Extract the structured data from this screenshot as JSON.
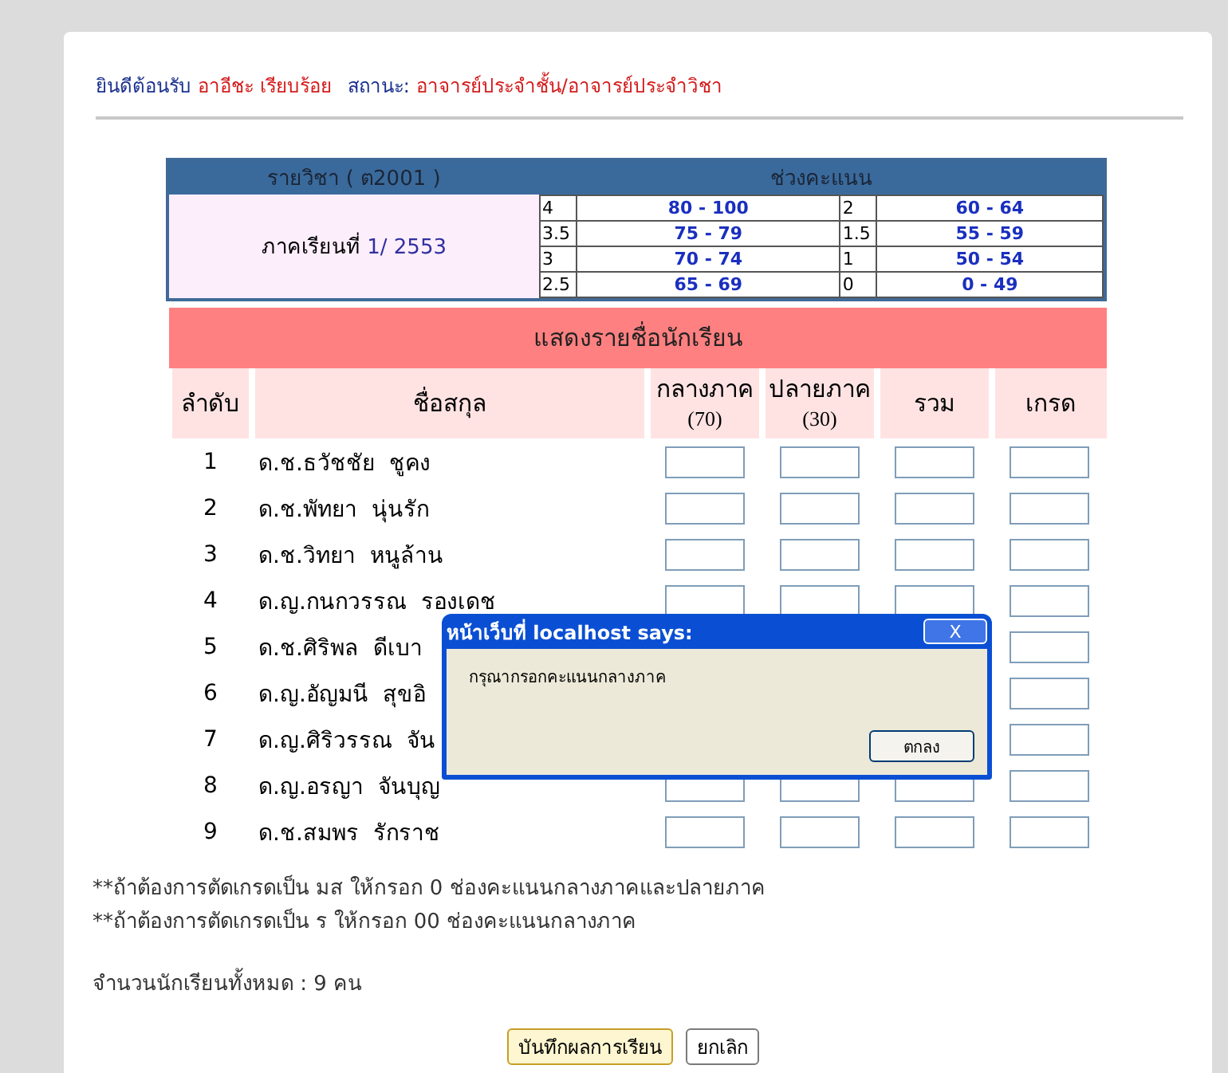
{
  "header": {
    "welcome": "ยินดีต้อนรับ",
    "user": "อาอีชะ เรียบร้อย",
    "status_label": "สถานะ:",
    "status": "อาจารย์ประจำชั้น/อาจารย์ประจำวิชา"
  },
  "subject": {
    "title": "รายวิชา ( ต2001 )",
    "term_label": "ภาคเรียนที่",
    "term": "1/",
    "year": "2553"
  },
  "score_ranges": {
    "title": "ช่วงคะแนน",
    "items": [
      {
        "grade": "4",
        "range": "80 - 100"
      },
      {
        "grade": "2",
        "range": "60 - 64"
      },
      {
        "grade": "3.5",
        "range": "75 - 79"
      },
      {
        "grade": "1.5",
        "range": "55 - 59"
      },
      {
        "grade": "3",
        "range": "70 - 74"
      },
      {
        "grade": "1",
        "range": "50 - 54"
      },
      {
        "grade": "2.5",
        "range": "65 - 69"
      },
      {
        "grade": "0",
        "range": "0 - 49"
      }
    ]
  },
  "student_table": {
    "title": "แสดงรายชื่อนักเรียน",
    "columns": [
      {
        "label": "ลำดับ"
      },
      {
        "label": "ชื่อสกุล"
      },
      {
        "label": "กลางภาค",
        "sub": "(70)"
      },
      {
        "label": "ปลายภาค",
        "sub": "(30)"
      },
      {
        "label": "รวม"
      },
      {
        "label": "เกรด"
      }
    ],
    "rows": [
      {
        "no": "1",
        "name": "ด.ช.ธวัชชัย  ชูคง"
      },
      {
        "no": "2",
        "name": "ด.ช.พัทยา  นุ่นรัก"
      },
      {
        "no": "3",
        "name": "ด.ช.วิทยา  หนูล้าน"
      },
      {
        "no": "4",
        "name": "ด.ญ.กนกวรรณ  รองเดช"
      },
      {
        "no": "5",
        "name": "ด.ช.ศิริพล  ดีเบา"
      },
      {
        "no": "6",
        "name": "ด.ญ.อัญมนี  สุขอิ"
      },
      {
        "no": "7",
        "name": "ด.ญ.ศิริวรรณ  จัน"
      },
      {
        "no": "8",
        "name": "ด.ญ.อรญา  จันบุญ"
      },
      {
        "no": "9",
        "name": "ด.ช.สมพร  รักราช"
      }
    ]
  },
  "notes": [
    "**ถ้าต้องการตัดเกรดเป็น มส ให้กรอก 0 ช่องคะแนนกลางภาคและปลายภาค",
    "**ถ้าต้องการตัดเกรดเป็น ร ให้กรอก 00 ช่องคะแนนกลางภาค"
  ],
  "student_count": "จำนวนนักเรียนทั้งหมด : 9 คน",
  "buttons": [
    "บันทึกผลการเรียน",
    "ยกเลิก"
  ],
  "dialog": {
    "title": "หน้าเว็บที่ localhost says:",
    "close": "X",
    "message": "กรุณากรอกคะแนนกลางภาค",
    "ok": "ตกลง"
  }
}
